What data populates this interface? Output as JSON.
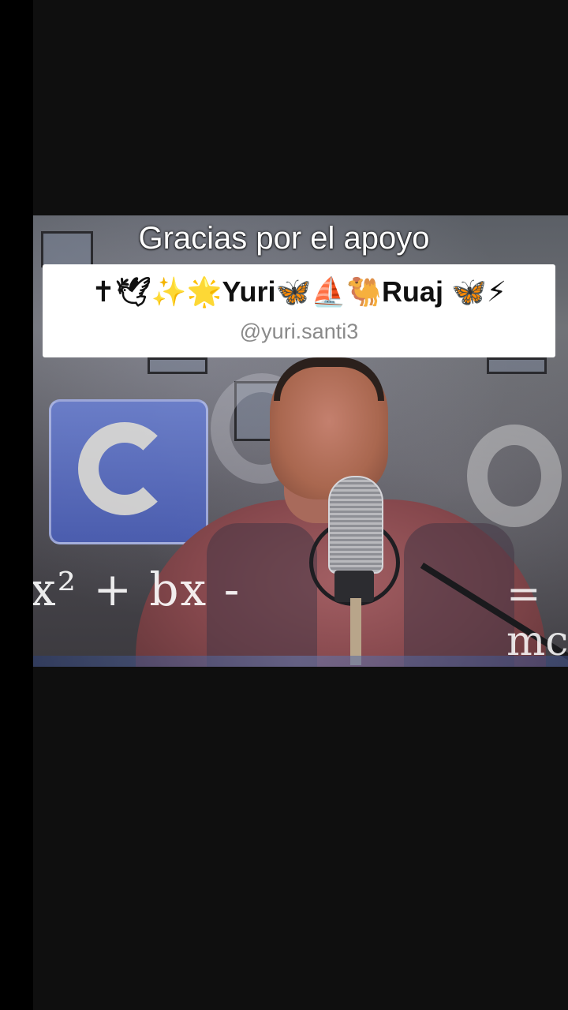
{
  "video": {
    "caption": "Gracias por el apoyo",
    "math_left": "x² + bx -",
    "math_right": "= mc"
  },
  "comment_card": {
    "title": "✝🕊✨🌟Yuri🦋⛵🐫Ruaj 🦋⚡",
    "handle": "@yuri.santi3"
  },
  "colors": {
    "background": "#0f0f0f",
    "card_background": "#ffffff",
    "handle_color": "#8a8a8a",
    "logo_blue": "#4b5fb8"
  }
}
